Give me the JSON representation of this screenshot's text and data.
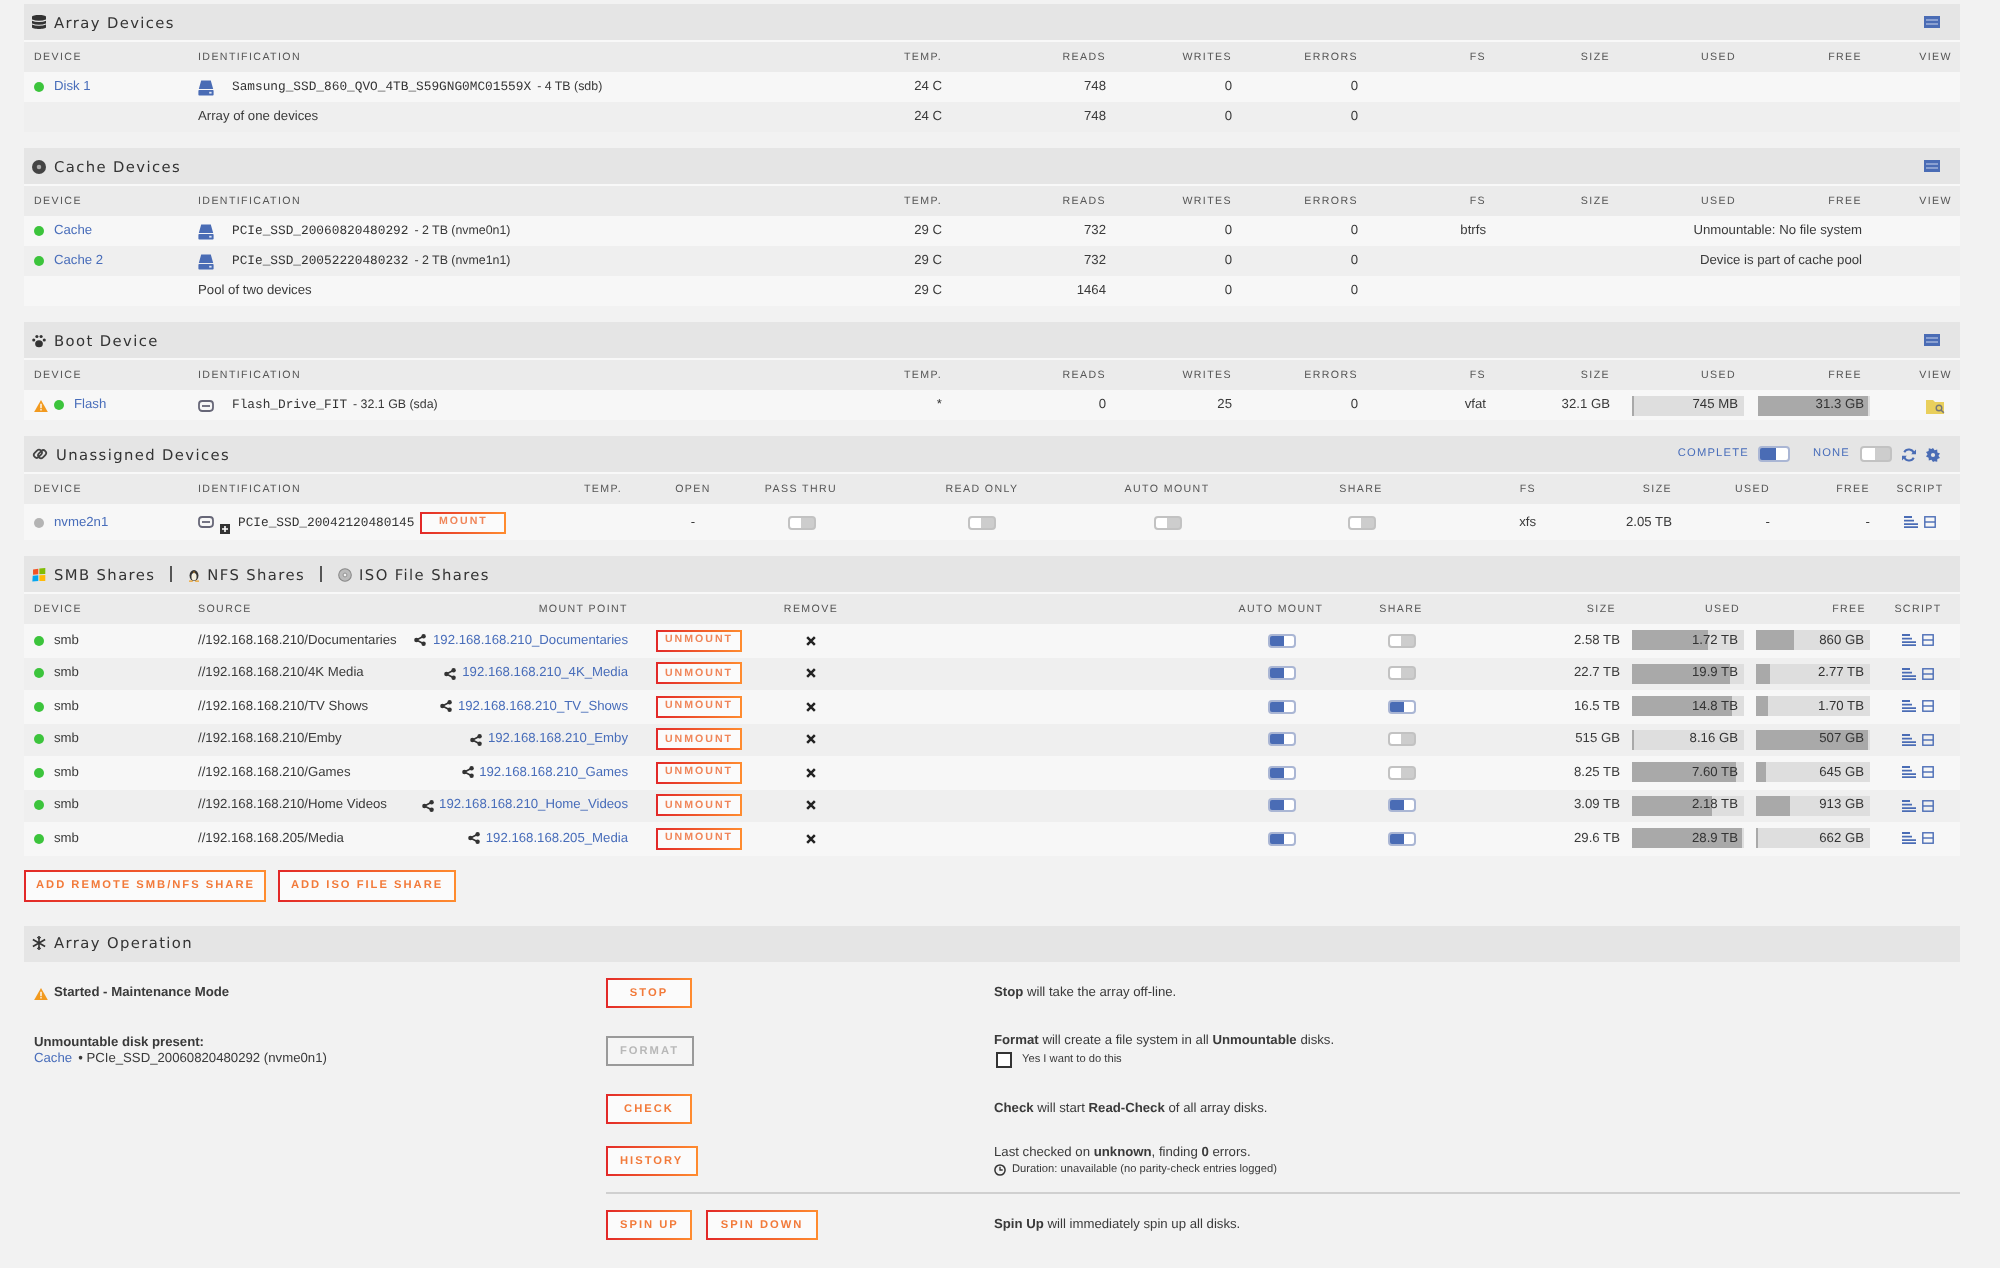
{
  "array_devices": {
    "title": "Array Devices",
    "columns": [
      "DEVICE",
      "IDENTIFICATION",
      "TEMP.",
      "READS",
      "WRITES",
      "ERRORS",
      "FS",
      "SIZE",
      "USED",
      "FREE",
      "VIEW"
    ],
    "rows": [
      {
        "kind": "device",
        "device": "Disk 1",
        "color": "#3cc43c",
        "identification": "Samsung_SSD_860_QVO_4TB_S59GNG0MC01559X",
        "capacity": "- 4 TB (sdb)",
        "temp": "24 C",
        "reads": "748",
        "writes": "0",
        "errors": "0"
      },
      {
        "kind": "summary",
        "identification": "Array of one devices",
        "temp": "24 C",
        "reads": "748",
        "writes": "0",
        "errors": "0"
      }
    ]
  },
  "cache_devices": {
    "title": "Cache Devices",
    "columns": [
      "DEVICE",
      "IDENTIFICATION",
      "TEMP.",
      "READS",
      "WRITES",
      "ERRORS",
      "FS",
      "SIZE",
      "USED",
      "FREE",
      "VIEW"
    ],
    "rows": [
      {
        "kind": "device",
        "device": "Cache",
        "color": "#3cc43c",
        "identification": "PCIe_SSD_20060820480292",
        "capacity": "- 2 TB (nvme0n1)",
        "temp": "29 C",
        "reads": "732",
        "writes": "0",
        "errors": "0",
        "fs": "btrfs",
        "note": "Unmountable: No file system"
      },
      {
        "kind": "device",
        "device": "Cache 2",
        "color": "#3cc43c",
        "identification": "PCIe_SSD_20052220480232",
        "capacity": "- 2 TB (nvme1n1)",
        "temp": "29 C",
        "reads": "732",
        "writes": "0",
        "errors": "0",
        "note": "Device is part of cache pool"
      },
      {
        "kind": "summary",
        "identification": "Pool of two devices",
        "temp": "29 C",
        "reads": "1464",
        "writes": "0",
        "errors": "0"
      }
    ]
  },
  "boot_device": {
    "title": "Boot Device",
    "columns": [
      "DEVICE",
      "IDENTIFICATION",
      "TEMP.",
      "READS",
      "WRITES",
      "ERRORS",
      "FS",
      "SIZE",
      "USED",
      "FREE",
      "VIEW"
    ],
    "rows": [
      {
        "kind": "device",
        "device": "Flash",
        "warning": true,
        "color": "#3cc43c",
        "identification": "Flash_Drive_FIT",
        "capacity": "- 32.1 GB (sda)",
        "temp": "*",
        "reads": "0",
        "writes": "25",
        "errors": "0",
        "fs": "vfat",
        "size": "32.1 GB",
        "used": {
          "text": "745 MB",
          "level": 0.02
        },
        "free": {
          "text": "31.3 GB",
          "level": 0.98
        },
        "view": true
      }
    ]
  },
  "unassigned_devices": {
    "title": "Unassigned Devices",
    "toggles": [
      {
        "label": "COMPLETE",
        "on": true
      },
      {
        "label": "NONE",
        "on": false
      }
    ],
    "columns": [
      "DEVICE",
      "IDENTIFICATION",
      "TEMP.",
      "OPEN",
      "PASS THRU",
      "READ ONLY",
      "AUTO MOUNT",
      "SHARE",
      "FS",
      "SIZE",
      "USED",
      "FREE",
      "SCRIPT"
    ],
    "rows": [
      {
        "device": "nvme2n1",
        "color": "#b4b4b4",
        "identification": "PCIe_SSD_20042120480145",
        "button": "MOUNT",
        "open": "-",
        "pass_thru": false,
        "read_only": false,
        "auto_mount": false,
        "share": false,
        "fs": "xfs",
        "size": "2.05 TB",
        "used": "-",
        "free": "-"
      }
    ]
  },
  "shares": {
    "titles": [
      "SMB Shares",
      "NFS Shares",
      "ISO File Shares"
    ],
    "columns": [
      "DEVICE",
      "SOURCE",
      "MOUNT POINT",
      "REMOVE",
      "AUTO MOUNT",
      "SHARE",
      "SIZE",
      "USED",
      "FREE",
      "SCRIPT"
    ],
    "rows": [
      {
        "device": "smb",
        "color": "#3cc43c",
        "source": "//192.168.168.210/Documentaries",
        "mount_point": "192.168.168.210_Documentaries",
        "button": "UNMOUNT",
        "auto_mount": true,
        "share": false,
        "size": "2.58 TB",
        "used": {
          "text": "1.72 TB",
          "level": 0.67
        },
        "free": {
          "text": "860 GB",
          "level": 0.33
        }
      },
      {
        "device": "smb",
        "color": "#3cc43c",
        "source": "//192.168.168.210/4K Media",
        "mount_point": "192.168.168.210_4K_Media",
        "button": "UNMOUNT",
        "auto_mount": true,
        "share": false,
        "size": "22.7 TB",
        "used": {
          "text": "19.9 TB",
          "level": 0.88
        },
        "free": {
          "text": "2.77 TB",
          "level": 0.12
        }
      },
      {
        "device": "smb",
        "color": "#3cc43c",
        "source": "//192.168.168.210/TV Shows",
        "mount_point": "192.168.168.210_TV_Shows",
        "button": "UNMOUNT",
        "auto_mount": true,
        "share": true,
        "size": "16.5 TB",
        "used": {
          "text": "14.8 TB",
          "level": 0.9
        },
        "free": {
          "text": "1.70 TB",
          "level": 0.1
        }
      },
      {
        "device": "smb",
        "color": "#3cc43c",
        "source": "//192.168.168.210/Emby",
        "mount_point": "192.168.168.210_Emby",
        "button": "UNMOUNT",
        "auto_mount": true,
        "share": false,
        "size": "515 GB",
        "used": {
          "text": "8.16 GB",
          "level": 0.02
        },
        "free": {
          "text": "507 GB",
          "level": 0.98
        }
      },
      {
        "device": "smb",
        "color": "#3cc43c",
        "source": "//192.168.168.210/Games",
        "mount_point": "192.168.168.210_Games",
        "button": "UNMOUNT",
        "auto_mount": true,
        "share": false,
        "size": "8.25 TB",
        "used": {
          "text": "7.60 TB",
          "level": 0.92
        },
        "free": {
          "text": "645 GB",
          "level": 0.08
        }
      },
      {
        "device": "smb",
        "color": "#3cc43c",
        "source": "//192.168.168.210/Home Videos",
        "mount_point": "192.168.168.210_Home_Videos",
        "button": "UNMOUNT",
        "auto_mount": true,
        "share": true,
        "size": "3.09 TB",
        "used": {
          "text": "2.18 TB",
          "level": 0.71
        },
        "free": {
          "text": "913 GB",
          "level": 0.29
        }
      },
      {
        "device": "smb",
        "color": "#3cc43c",
        "source": "//192.168.168.205/Media",
        "mount_point": "192.168.168.205_Media",
        "button": "UNMOUNT",
        "auto_mount": true,
        "share": true,
        "size": "29.6 TB",
        "used": {
          "text": "28.9 TB",
          "level": 0.98
        },
        "free": {
          "text": "662 GB",
          "level": 0.02
        }
      }
    ],
    "buttons": [
      "ADD REMOTE SMB/NFS SHARE",
      "ADD ISO FILE SHARE"
    ]
  },
  "array_operation": {
    "title": "Array Operation",
    "rows": [
      {
        "kind": "status",
        "warning": true,
        "status": "Started - Maintenance Mode",
        "buttons": [
          {
            "label": "STOP",
            "disabled": false
          }
        ],
        "description": "**Stop** will take the array off-line."
      },
      {
        "kind": "unmountable",
        "heading": "Unmountable disk present:",
        "link": "Cache",
        "detail": "• PCIe_SSD_20060820480292 (nvme0n1)",
        "buttons": [
          {
            "label": "FORMAT",
            "disabled": true
          }
        ],
        "description": "**Format** will create a file system in all **Unmountable** disks.",
        "confirm": {
          "label": "Yes I want to do this",
          "checked": false
        }
      },
      {
        "kind": "action",
        "buttons": [
          {
            "label": "CHECK",
            "disabled": false
          }
        ],
        "description": "**Check** will start **Read-Check** of all array disks."
      },
      {
        "kind": "action",
        "buttons": [
          {
            "label": "HISTORY",
            "disabled": false
          }
        ],
        "description": "Last checked on **unknown**, finding **0** errors.",
        "note": "Duration: unavailable (no parity-check entries logged)"
      }
    ],
    "spin": {
      "buttons": [
        {
          "label": "SPIN UP",
          "disabled": false
        },
        {
          "label": "SPIN DOWN",
          "disabled": false
        }
      ],
      "description": "**Spin Up** will immediately spin up all disks."
    }
  }
}
